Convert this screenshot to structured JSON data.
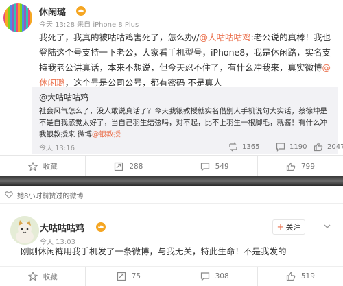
{
  "post1": {
    "username": "休闲璐",
    "meta": "今天 13:28 来自 iPhone 8 Plus",
    "text_before_link": "我死了，我真的被咕咕鸡害死了，怎么办//",
    "mention1": "@大咕咕咕鸡",
    "text_middle": ":老公说的真棒！我也登陆这个号支持一下老公，大家看手机型号，iPhone8，我是休闲路，实名支持我老公讲真话，本来不想说，但今天忍不住了，有什么冲我来，真实微博",
    "mention2": "@休闲璐",
    "text_after": "，这个号是公司公号，都有密码 不是真人",
    "repost": {
      "user": "@大咕咕咕鸡",
      "text_before": "社会风气怎么了，没人敢说真话了？今天我银教授就实名借别人手机说句大实话，蔡徐坤是不是自我感觉太好了，当自己羽生结弦吗，对不起，比不上羽生一根脚毛，就酱！有什么冲我银教授来 微博",
      "link": "@银教授",
      "meta": "今天 13:16",
      "reposts": "1365",
      "comments": "1190",
      "likes": "2047"
    },
    "actions": {
      "favorite": "收藏",
      "repost": "288",
      "comment": "549",
      "like": "799"
    }
  },
  "notice": "她8小时前赞过的微博",
  "post2": {
    "username": "大咕咕咕鸡",
    "meta": "今天 13:03",
    "follow": "关注",
    "text": "刚刚休闲裤用我手机发了一条微博，与我无关，特此生命！不是我发的",
    "actions": {
      "favorite": "收藏",
      "repost": "75",
      "comment": "308",
      "like": "519"
    }
  },
  "colors": {
    "link": "#eb7350",
    "vip": "#f5a623"
  },
  "icons": [
    "vip-crown-icon",
    "star-icon",
    "repost-icon",
    "comment-icon",
    "like-icon",
    "chevron-down-icon",
    "heart-icon"
  ]
}
